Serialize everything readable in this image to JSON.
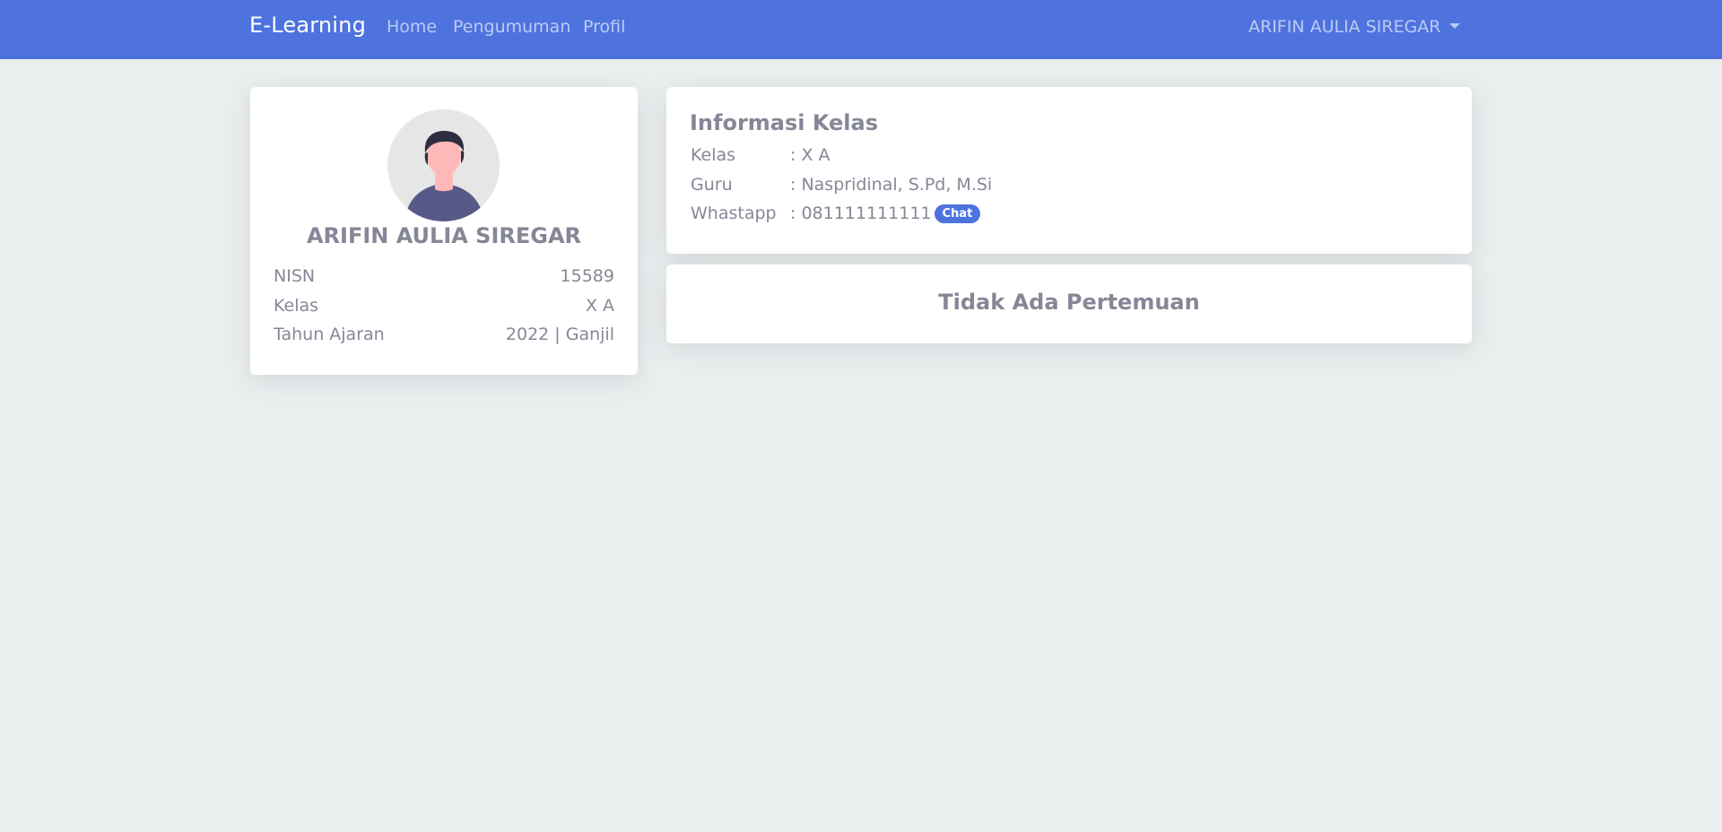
{
  "navbar": {
    "brand": "E-Learning",
    "links": [
      {
        "label": "Home"
      },
      {
        "label": "Pengumuman"
      },
      {
        "label": "Profil"
      }
    ],
    "user_menu": "ARIFIN AULIA SIREGAR",
    "color": "#4e73df"
  },
  "profile": {
    "name": "ARIFIN AULIA SIREGAR",
    "avatar_icon": "user-avatar-icon",
    "rows": [
      {
        "label": "NISN",
        "value": "15589"
      },
      {
        "label": "Kelas",
        "value": "X A"
      },
      {
        "label": "Tahun Ajaran",
        "value": "2022 | Ganjil"
      }
    ]
  },
  "class_info": {
    "title": "Informasi Kelas",
    "rows": [
      {
        "label": "Kelas",
        "value": ": X A"
      },
      {
        "label": "Guru",
        "value": ": Naspridinal, S.Pd, M.Si"
      },
      {
        "label": "Whastapp",
        "value": ": 081111111111"
      }
    ],
    "chat_label": "Chat"
  },
  "meeting": {
    "message": "Tidak Ada Pertemuan"
  }
}
